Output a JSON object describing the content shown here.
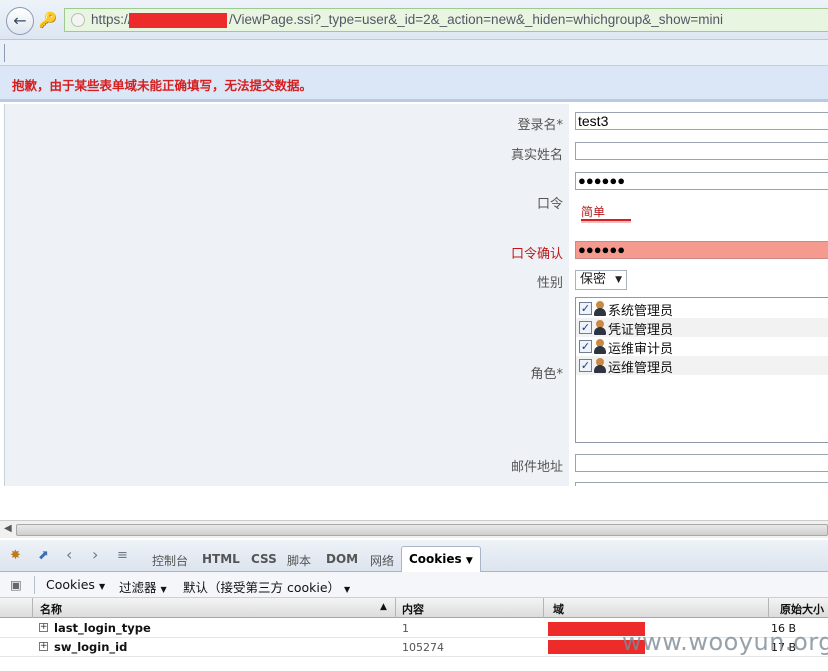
{
  "browser": {
    "url_prefix": "https://",
    "url_suffix": "/ViewPage.ssi?_type=user&_id=2&_action=new&_hiden=whichgroup&_show=mini"
  },
  "error_message": "抱歉，由于某些表单域未能正确填写，无法提交数据。",
  "form": {
    "login_label": "登录名*",
    "login_value": "test3",
    "realname_label": "真实姓名",
    "realname_value": "",
    "password_label": "口令",
    "password_value": "●●●●●●",
    "password_strength": "简单",
    "confirm_label": "口令确认",
    "confirm_value": "●●●●●●",
    "gender_label": "性别",
    "gender_value": "保密",
    "role_label": "角色*",
    "roles": [
      {
        "name": "系统管理员",
        "checked": true
      },
      {
        "name": "凭证管理员",
        "checked": true
      },
      {
        "name": "运维审计员",
        "checked": true
      },
      {
        "name": "运维管理员",
        "checked": true
      }
    ],
    "email_label": "邮件地址"
  },
  "firebug": {
    "tabs": [
      "控制台",
      "HTML",
      "CSS",
      "脚本",
      "DOM",
      "网络",
      "Cookies"
    ],
    "active_tab": "Cookies",
    "sub_cookies": "Cookies",
    "sub_filter": "过滤器",
    "sub_default": "默认（接受第三方 cookie）",
    "columns": {
      "name": "名称",
      "content": "内容",
      "domain": "域",
      "raw_size": "原始大小"
    },
    "rows": [
      {
        "name": "last_login_type",
        "value": "1",
        "size": "16 B"
      },
      {
        "name": "sw_login_id",
        "value": "105274",
        "size": "17 B"
      }
    ]
  },
  "watermark": "www.wooyun.org",
  "colors": {
    "error_red": "#d62020",
    "redaction": "#ee2b2b",
    "confirm_bg": "#f49a8e"
  }
}
